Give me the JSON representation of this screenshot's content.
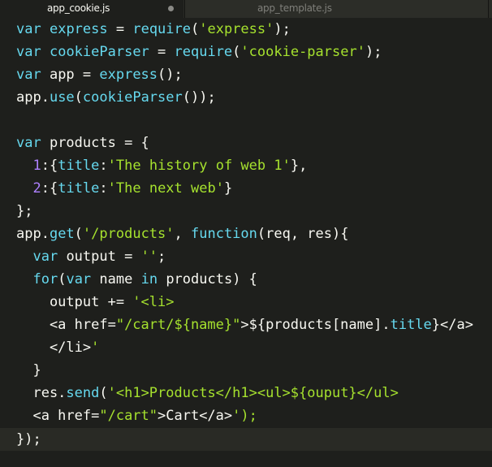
{
  "tabs": [
    {
      "label": "app_cookie.js",
      "active": true,
      "modified": true
    },
    {
      "label": "app_template.js",
      "active": false,
      "modified": false
    }
  ],
  "code_lines": [
    "var express = require('express');",
    "var cookieParser = require('cookie-parser');",
    "var app = express();",
    "app.use(cookieParser());",
    "",
    "var products = {",
    "  1:{title:'The history of web 1'},",
    "  2:{title:'The next web'}",
    "};",
    "app.get('/products', function(req, res){",
    "  var output = '';",
    "  for(var name in products) {",
    "    output += '<li>",
    "    <a href=\"/cart/${name}\">${products[name].title}</a>",
    "    </li>'",
    "  }",
    "  res.send('<h1>Products</h1><ul>${ouput}</ul>",
    "  <a href=\"/cart\">Cart</a>');",
    "});"
  ],
  "colors": {
    "background": "#1e1f1c",
    "keyword": "#66d9ef",
    "string": "#a6e22e",
    "number": "#ae81ff",
    "text": "#f8f8f2"
  }
}
